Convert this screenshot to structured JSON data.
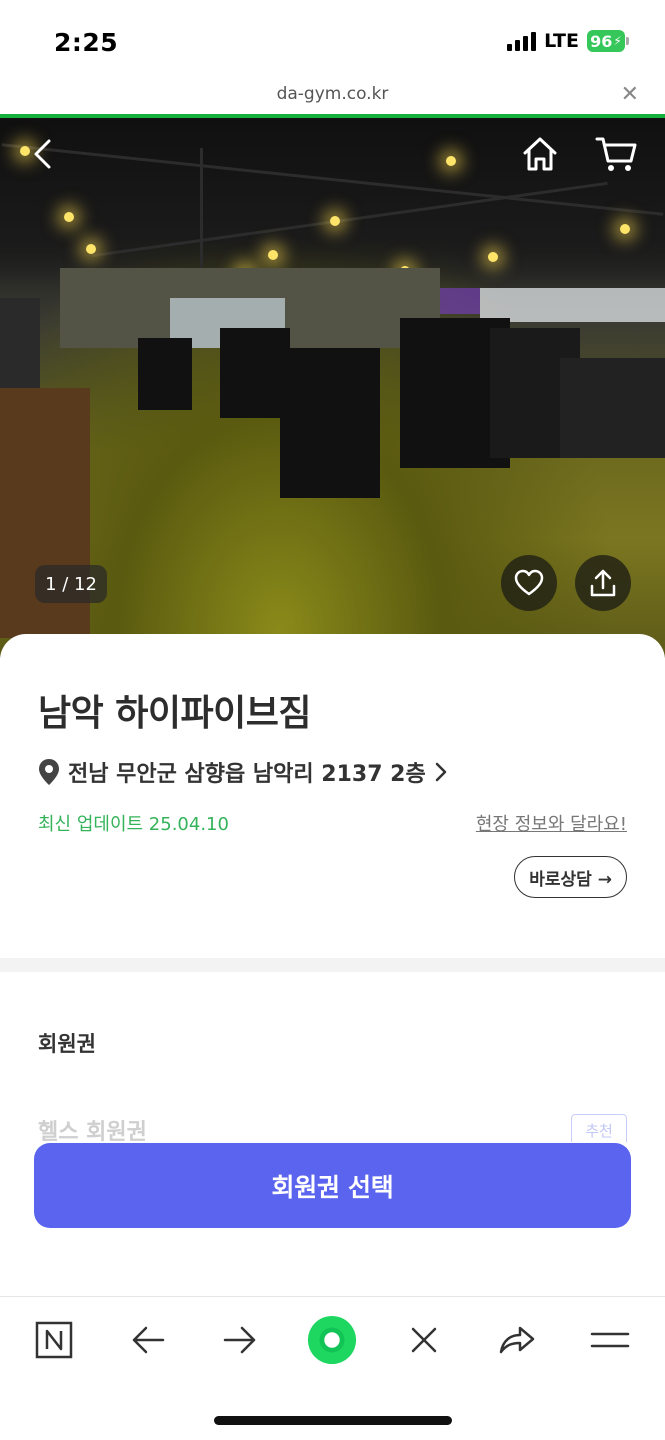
{
  "status_bar": {
    "time": "2:25",
    "network": "LTE",
    "battery": "96"
  },
  "browser": {
    "url": "da-gym.co.kr",
    "close_icon": "close-icon",
    "load_progress": 1.0,
    "load_color": "#13b13b"
  },
  "hero": {
    "image_counter": "1 / 12",
    "icons": [
      "back-arrow-icon",
      "home-icon",
      "cart-icon",
      "heart-icon",
      "share-icon"
    ]
  },
  "gym": {
    "name": "남악 하이파이브짐",
    "address": "전남 무안군 삼향읍 남악리 2137 2층",
    "update": "최신 업데이트 25.04.10",
    "report_link": "현장 정보와 달라요!",
    "consult_label": "바로상담 →"
  },
  "membership": {
    "section_title": "회원권",
    "peek_item": "헬스 회원권",
    "peek_tag": "추천"
  },
  "cta": {
    "label": "회원권 선택",
    "color": "#5b64ef"
  },
  "toolbar": {
    "items": [
      "naver-icon",
      "back-icon",
      "forward-icon",
      "green-dot-icon",
      "close-icon",
      "share-icon",
      "menu-icon"
    ],
    "accent": "#1ed760"
  }
}
